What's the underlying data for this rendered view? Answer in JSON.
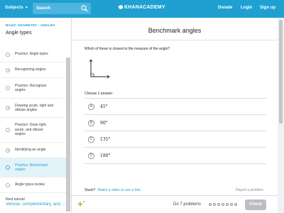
{
  "header": {
    "subjects_label": "Subjects",
    "search_placeholder": "Search",
    "logo_text": "KHANACADEMY",
    "donate_label": "Donate",
    "login_label": "Login",
    "signup_label": "Sign up",
    "bar_color": "#1fa0d1"
  },
  "sidebar": {
    "breadcrumb": "BASIC GEOMETRY › ANGLES",
    "title": "Angle types",
    "items": [
      {
        "label": "Practice: Angle types",
        "icon": "play-icon",
        "active": false
      },
      {
        "label": "Recognizing angles",
        "icon": "play-icon",
        "active": false
      },
      {
        "label": "Practice: Recognize angles",
        "icon": "circle-icon",
        "active": false
      },
      {
        "label": "Drawing acute, right and obtuse angles",
        "icon": "play-icon",
        "active": false
      },
      {
        "label": "Practice: Draw right, acute, and obtuse angles",
        "icon": "circle-icon",
        "active": false
      },
      {
        "label": "Identifying an angle",
        "icon": "play-icon",
        "active": false
      },
      {
        "label": "Practice: Benchmark angles",
        "icon": "circle-icon",
        "active": true
      },
      {
        "label": "Angle types review",
        "icon": "circle-icon",
        "active": false
      }
    ],
    "next_tutorial_label": "Next tutorial",
    "next_tutorial_link": "Vertical, complementary, and supplementary angles"
  },
  "main": {
    "title": "Benchmark angles",
    "question": "Which of these is closest to the measure of the angle?",
    "choose_label": "Choose 1 answer:",
    "choices": [
      {
        "letter": "A",
        "value": "45°"
      },
      {
        "letter": "B",
        "value": "90°"
      },
      {
        "letter": "C",
        "value": "135°"
      },
      {
        "letter": "D",
        "value": "180°"
      }
    ],
    "stuck_label": "Stuck?",
    "hint_link": "Watch a video or use a hint.",
    "report_label": "Report a problem"
  },
  "footer": {
    "progress_label": "Do 7 problems",
    "problem_count": 7,
    "check_label": "Check"
  }
}
